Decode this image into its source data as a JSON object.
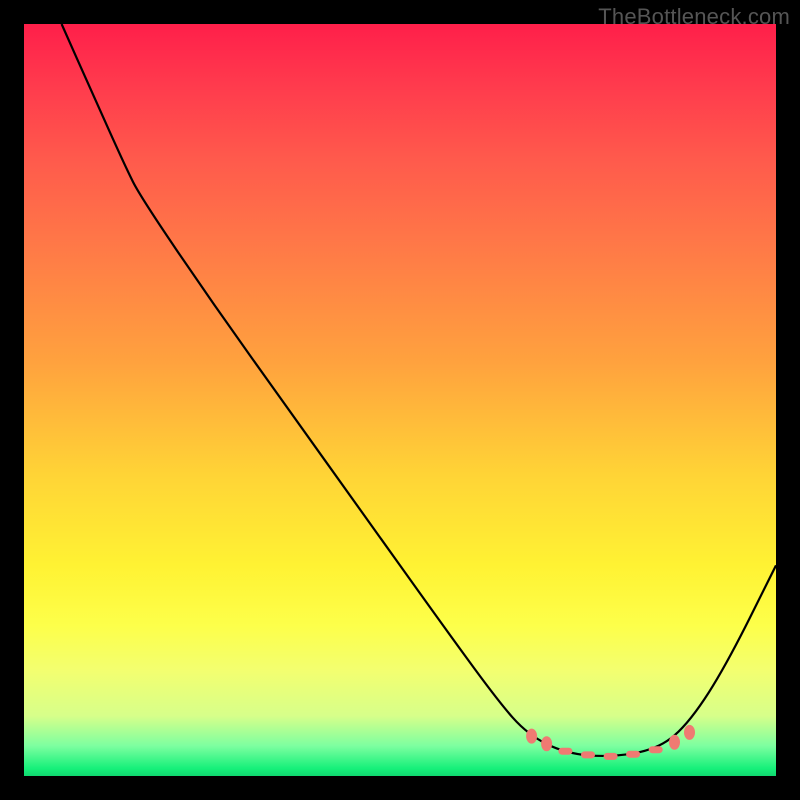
{
  "watermark": "TheBottleneck.com",
  "chart_data": {
    "type": "line",
    "title": "",
    "xlabel": "",
    "ylabel": "",
    "xlim": [
      0,
      100
    ],
    "ylim": [
      0,
      100
    ],
    "grid": false,
    "legend": false,
    "background": "heat-gradient",
    "curve_points": [
      {
        "x": 5.0,
        "y": 100.0
      },
      {
        "x": 9.0,
        "y": 91.0
      },
      {
        "x": 13.5,
        "y": 81.0
      },
      {
        "x": 15.5,
        "y": 77.0
      },
      {
        "x": 25.0,
        "y": 63.0
      },
      {
        "x": 35.0,
        "y": 49.0
      },
      {
        "x": 45.0,
        "y": 35.0
      },
      {
        "x": 55.0,
        "y": 21.0
      },
      {
        "x": 63.0,
        "y": 10.0
      },
      {
        "x": 67.0,
        "y": 5.5
      },
      {
        "x": 72.0,
        "y": 3.0
      },
      {
        "x": 78.0,
        "y": 2.5
      },
      {
        "x": 84.0,
        "y": 3.5
      },
      {
        "x": 88.0,
        "y": 6.5
      },
      {
        "x": 93.0,
        "y": 14.0
      },
      {
        "x": 100.0,
        "y": 28.0
      }
    ],
    "highlight_range_x": [
      67,
      89
    ],
    "highlight_markers": [
      {
        "x": 67.5,
        "y": 5.3,
        "type": "dot"
      },
      {
        "x": 69.5,
        "y": 4.3,
        "type": "dot"
      },
      {
        "x": 72.0,
        "y": 3.3,
        "type": "dash"
      },
      {
        "x": 75.0,
        "y": 2.8,
        "type": "dash"
      },
      {
        "x": 78.0,
        "y": 2.6,
        "type": "dash"
      },
      {
        "x": 81.0,
        "y": 2.9,
        "type": "dash"
      },
      {
        "x": 84.0,
        "y": 3.5,
        "type": "dash"
      },
      {
        "x": 86.5,
        "y": 4.5,
        "type": "dot"
      },
      {
        "x": 88.5,
        "y": 5.8,
        "type": "dot"
      }
    ]
  }
}
